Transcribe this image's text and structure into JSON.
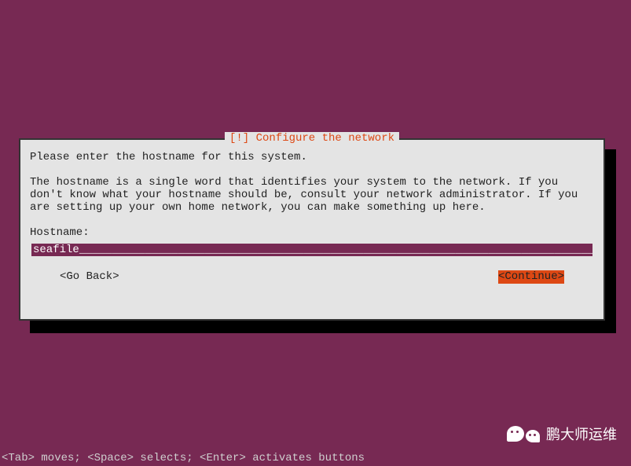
{
  "dialog": {
    "title": "[!] Configure the network",
    "intro": "Please enter the hostname for this system.",
    "description": "The hostname is a single word that identifies your system to the network. If you don't know what your hostname should be, consult your network administrator. If you are setting up your own home network, you can make something up here.",
    "field_label": "Hostname:",
    "field_value": "seafile",
    "go_back": "<Go Back>",
    "continue": "<Continue>"
  },
  "hint": "<Tab> moves; <Space> selects; <Enter> activates buttons",
  "watermark": "鹏大师运维"
}
